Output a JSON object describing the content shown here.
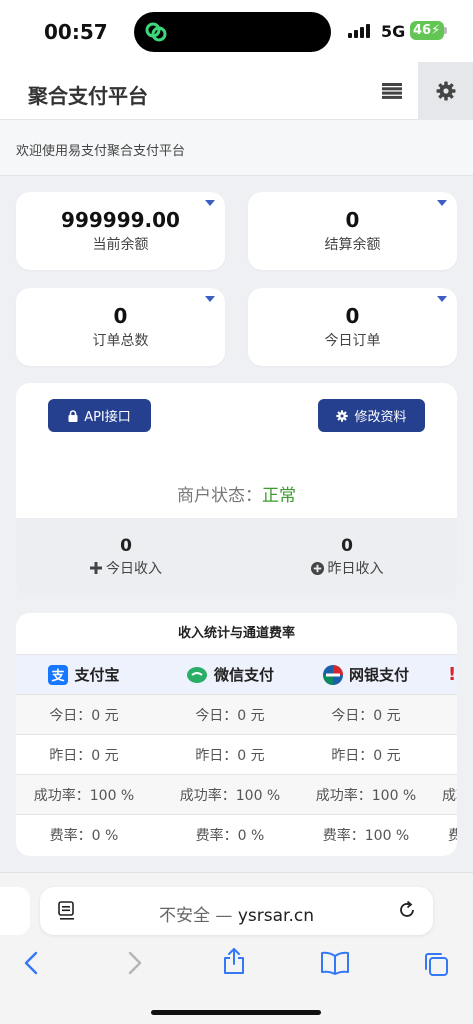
{
  "status_bar": {
    "time": "00:57",
    "network": "5G",
    "battery": "46"
  },
  "header": {
    "title": "聚合支付平台",
    "menu_icon": "list-icon",
    "settings_icon": "gear-icon"
  },
  "welcome": {
    "text": "欢迎使用易支付聚合支付平台"
  },
  "stats": [
    {
      "value": "999999.00",
      "label": "当前余额"
    },
    {
      "value": "0",
      "label": "结算余额"
    },
    {
      "value": "0",
      "label": "订单总数"
    },
    {
      "value": "0",
      "label": "今日订单"
    }
  ],
  "merchant": {
    "api_button": "API接口",
    "edit_button": "修改资料",
    "status_label": "商户状态：",
    "status_value": "正常",
    "today_income": {
      "value": "0",
      "label": "今日收入"
    },
    "yesterday_income": {
      "value": "0",
      "label": "昨日收入"
    }
  },
  "rates": {
    "title": "收入统计与通道费率",
    "channels": [
      "支付宝",
      "微信支付",
      "网银支付"
    ],
    "rows": [
      [
        "今日：0 元",
        "今日：0 元",
        "今日：0 元"
      ],
      [
        "昨日：0 元",
        "昨日：0 元",
        "昨日：0 元"
      ],
      [
        "成功率：100 %",
        "成功率：100 %",
        "成功率：100 %",
        "成功"
      ],
      [
        "费率：0 %",
        "费率：0 %",
        "费率：100 %",
        "费"
      ]
    ]
  },
  "browser": {
    "insecure_label": "不安全 — ",
    "domain": "ysrsar.cn"
  },
  "colors": {
    "primary": "#25408f",
    "status_ok": "#3c9a2f",
    "ios_blue": "#3478f6"
  }
}
